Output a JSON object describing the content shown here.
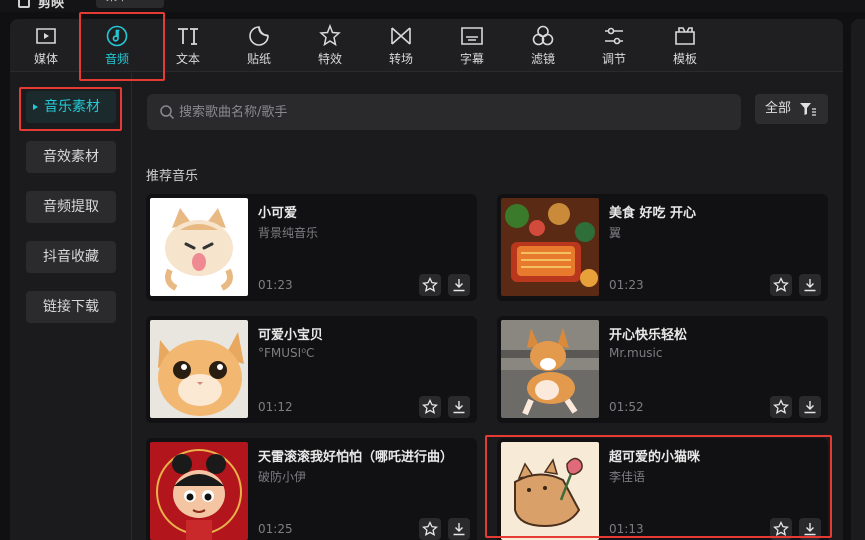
{
  "app": {
    "name": "剪映",
    "menu_label": "菜单"
  },
  "tabs": [
    {
      "label": "媒体",
      "icon": "media-icon"
    },
    {
      "label": "音频",
      "icon": "audio-icon",
      "active": true
    },
    {
      "label": "文本",
      "icon": "text-icon"
    },
    {
      "label": "贴纸",
      "icon": "sticker-icon"
    },
    {
      "label": "特效",
      "icon": "effects-icon"
    },
    {
      "label": "转场",
      "icon": "transition-icon"
    },
    {
      "label": "字幕",
      "icon": "subtitle-icon"
    },
    {
      "label": "滤镜",
      "icon": "filter-icon"
    },
    {
      "label": "调节",
      "icon": "adjust-icon"
    },
    {
      "label": "模板",
      "icon": "template-icon"
    }
  ],
  "sidebar": {
    "items": [
      {
        "label": "音乐素材",
        "active": true
      },
      {
        "label": "音效素材"
      },
      {
        "label": "音频提取"
      },
      {
        "label": "抖音收藏"
      },
      {
        "label": "链接下载"
      }
    ]
  },
  "search": {
    "placeholder": "搜索歌曲名称/歌手",
    "value": ""
  },
  "filter": {
    "label": "全部"
  },
  "section": {
    "title": "推荐音乐"
  },
  "tracks": [
    {
      "title": "小可爱",
      "artist": "背景纯音乐",
      "duration": "01:23",
      "thumb": "cartoon-cat"
    },
    {
      "title": "美食 好吃 开心",
      "artist": "翼",
      "duration": "01:23",
      "thumb": "food-spread"
    },
    {
      "title": "可爱小宝贝",
      "artist": "°FMUSI⁰C",
      "duration": "01:12",
      "thumb": "kitten"
    },
    {
      "title": "开心快乐轻松",
      "artist": "Mr.music",
      "duration": "01:52",
      "thumb": "corgi"
    },
    {
      "title": "天雷滚滚我好怕怕（哪吒进行曲）",
      "artist": "破防小伊",
      "duration": "01:25",
      "thumb": "nezha"
    },
    {
      "title": "超可爱的小猫咪",
      "artist": "李佳语",
      "duration": "01:13",
      "thumb": "cat-with-flower"
    }
  ],
  "colors": {
    "accent": "#23c9d6",
    "highlight": "#e53b34",
    "panel": "#1b1b1d",
    "card": "#111113"
  }
}
